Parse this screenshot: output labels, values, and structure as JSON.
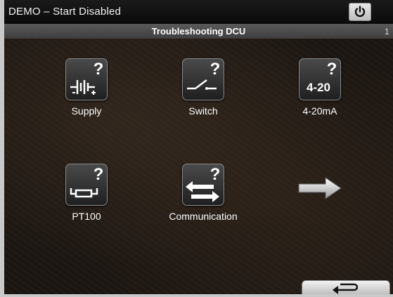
{
  "window": {
    "title": "DEMO – Start Disabled"
  },
  "header": {
    "title": "Troubleshooting DCU",
    "page": "1"
  },
  "tiles": [
    {
      "label": "Supply"
    },
    {
      "label": "Switch"
    },
    {
      "label": "4-20mA",
      "icon_text": "4-20"
    },
    {
      "label": "PT100"
    },
    {
      "label": "Communication"
    }
  ],
  "icons": {
    "power": "power-icon",
    "supply": "battery-icon",
    "switch": "switch-icon",
    "analog": "4-20-icon",
    "pt100": "pt100-sensor-icon",
    "communication": "bidirectional-arrows-icon",
    "next": "arrow-right-icon",
    "back": "return-arrow-icon"
  },
  "colors": {
    "background": "#1c1612",
    "header": "#4a4a4a",
    "text": "#ffffff"
  }
}
